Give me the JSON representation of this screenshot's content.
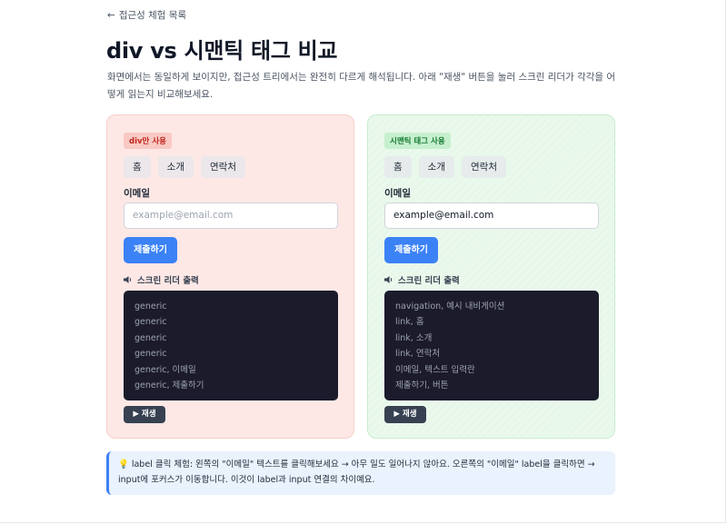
{
  "back": {
    "arrow": "←",
    "label": "접근성 체험 목록"
  },
  "title": "div vs 시맨틱 태그 비교",
  "intro": "화면에서는 동일하게 보이지만, 접근성 트리에서는 완전히 다르게 해석됩니다. 아래 \"재생\" 버튼을 눌러 스크린 리더가 각각을 어떻게 읽는지 비교해보세요.",
  "left": {
    "badge": "div만 사용",
    "nav": [
      "홈",
      "소개",
      "연락처"
    ],
    "field_label": "이메일",
    "field_placeholder": "example@email.com",
    "submit": "제출하기",
    "sr_title": "스크린 리더 출력",
    "output": [
      "generic",
      "generic",
      "generic",
      "generic",
      "generic, 이메일",
      "generic, 제출하기"
    ],
    "play": "▶ 재생"
  },
  "right": {
    "badge": "시맨틱 태그 사용",
    "nav": [
      "홈",
      "소개",
      "연락처"
    ],
    "field_label": "이메일",
    "field_value": "example@email.com",
    "submit": "제출하기",
    "sr_title": "스크린 리더 출력",
    "output": [
      "navigation, 예시 내비게이션",
      "link, 홈",
      "link, 소개",
      "link, 연락처",
      "이메일, 텍스트 입력란",
      "제출하기, 버튼"
    ],
    "play": "▶ 재생"
  },
  "tip": {
    "icon": "lightbulb-icon",
    "text": "💡 label 클릭 체험: 왼쪽의 \"이메일\" 텍스트를 클릭해보세요 → 아무 일도 일어나지 않아요. 오른쪽의 \"이메일\" label을 클릭하면 → input에 포커스가 이동합니다. 이것이 label과 input 연결의 차이예요."
  },
  "colors": {
    "accent": "#3b82f6",
    "div_panel": "#fde8e6",
    "semantic_panel": "#e7f8ea",
    "console": "#1b1b2b"
  }
}
